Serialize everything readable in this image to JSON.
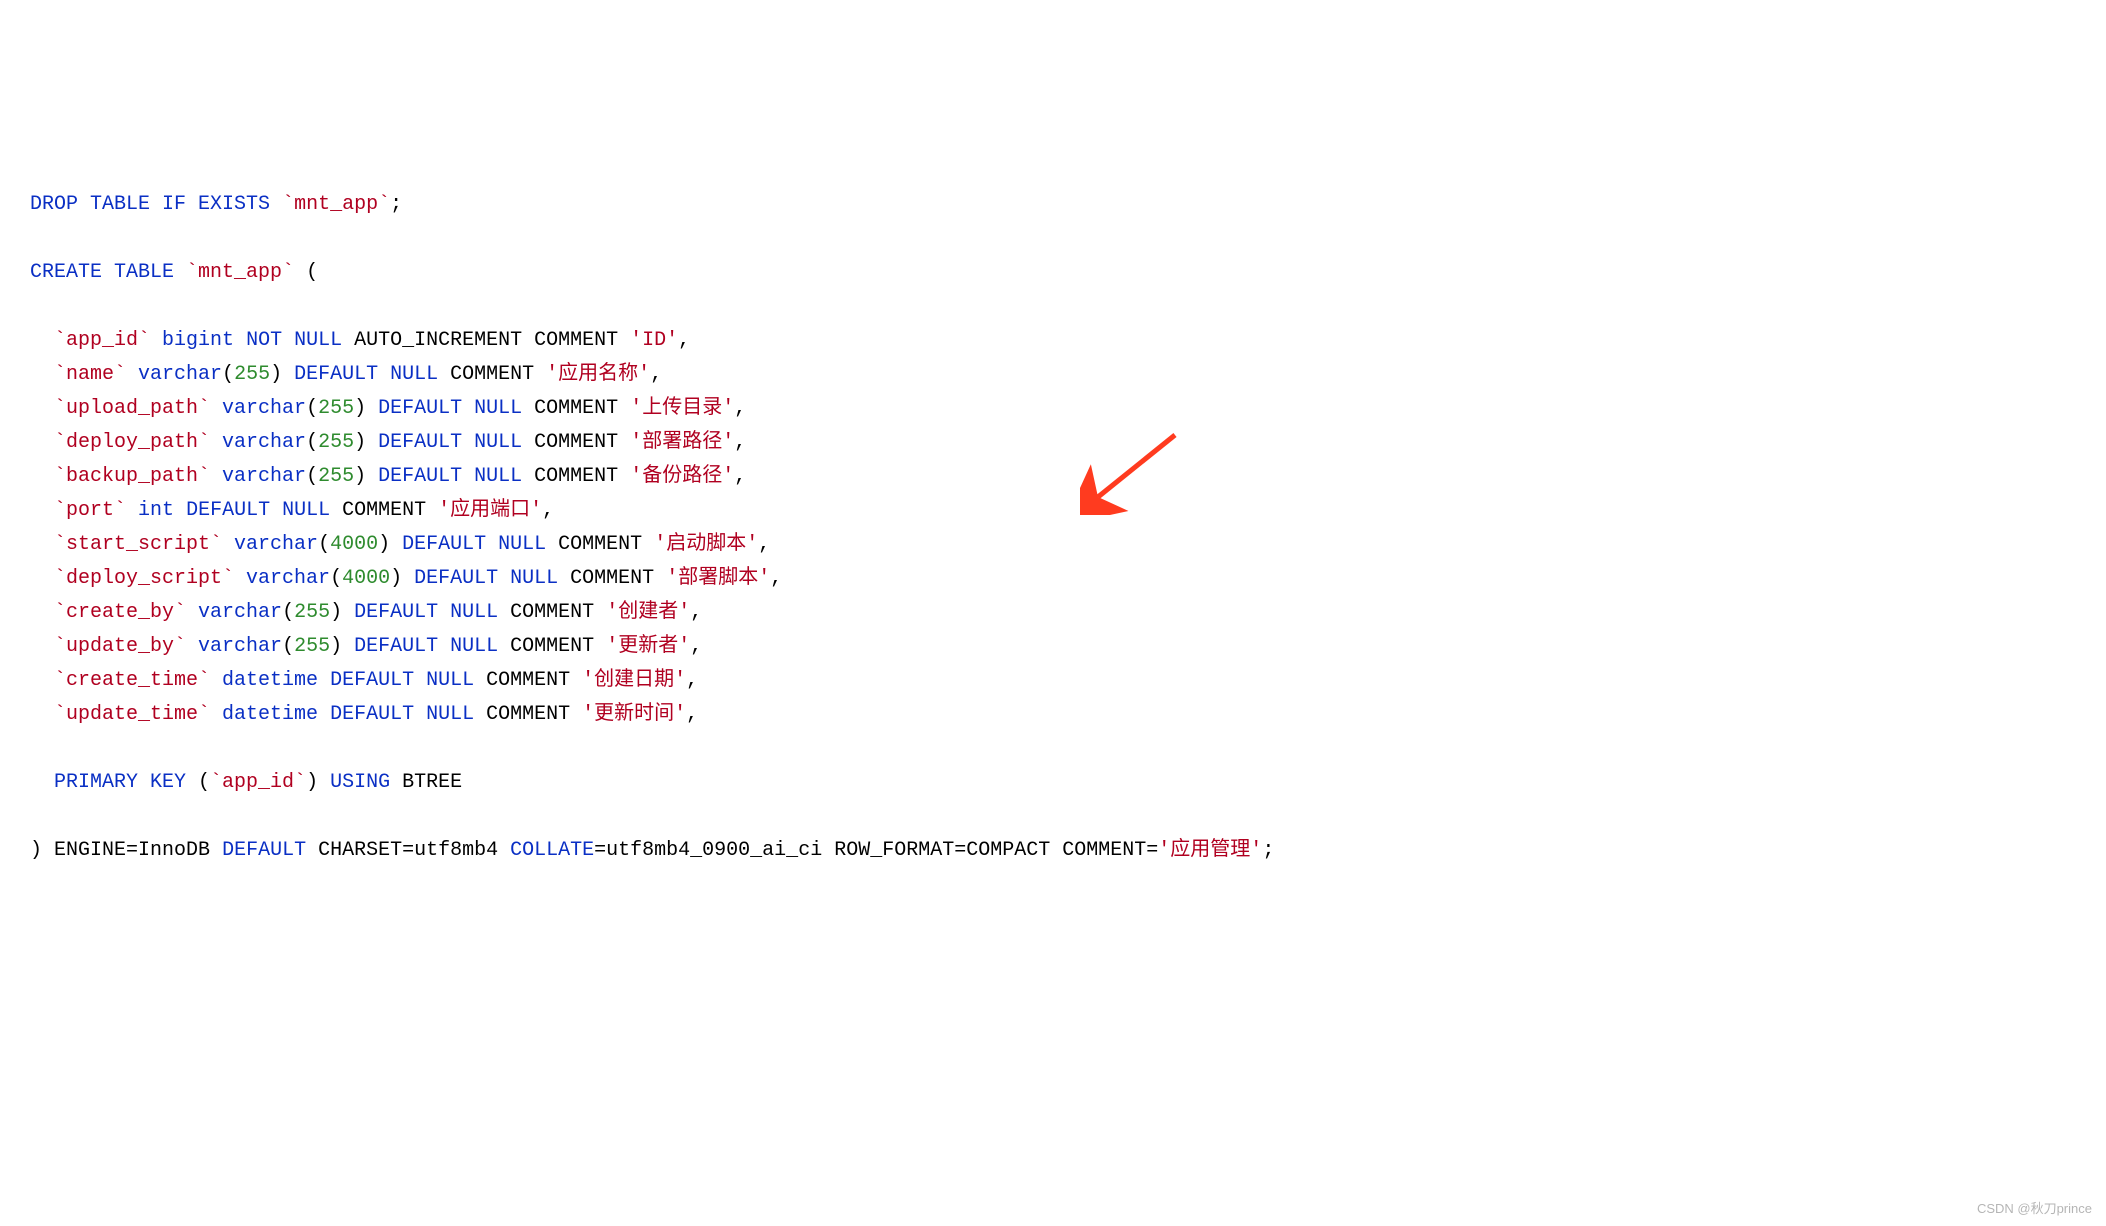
{
  "sql": {
    "drop": {
      "kw": "DROP TABLE IF EXISTS",
      "name": "`mnt_app`",
      "semi": ";"
    },
    "create": {
      "kw": "CREATE TABLE",
      "name": "`mnt_app`",
      "open": " ("
    },
    "cols": [
      {
        "name": "`app_id`",
        "type": "bigint",
        "size": "",
        "mid": "NOT NULL",
        "extra": "AUTO_INCREMENT COMMENT ",
        "str": "'ID'",
        "tail": ","
      },
      {
        "name": "`name`",
        "type": "varchar",
        "size": "255",
        "mid": "DEFAULT NULL",
        "extra": "COMMENT ",
        "str": "'应用名称'",
        "tail": ","
      },
      {
        "name": "`upload_path`",
        "type": "varchar",
        "size": "255",
        "mid": "DEFAULT NULL",
        "extra": "COMMENT ",
        "str": "'上传目录'",
        "tail": ","
      },
      {
        "name": "`deploy_path`",
        "type": "varchar",
        "size": "255",
        "mid": "DEFAULT NULL",
        "extra": "COMMENT ",
        "str": "'部署路径'",
        "tail": ","
      },
      {
        "name": "`backup_path`",
        "type": "varchar",
        "size": "255",
        "mid": "DEFAULT NULL",
        "extra": "COMMENT ",
        "str": "'备份路径'",
        "tail": ","
      },
      {
        "name": "`port`",
        "type": "int",
        "size": "",
        "mid": "DEFAULT NULL",
        "extra": "COMMENT ",
        "str": "'应用端口'",
        "tail": ","
      },
      {
        "name": "`start_script`",
        "type": "varchar",
        "size": "4000",
        "mid": "DEFAULT NULL",
        "extra": "COMMENT ",
        "str": "'启动脚本'",
        "tail": ","
      },
      {
        "name": "`deploy_script`",
        "type": "varchar",
        "size": "4000",
        "mid": "DEFAULT NULL",
        "extra": "COMMENT ",
        "str": "'部署脚本'",
        "tail": ","
      },
      {
        "name": "`create_by`",
        "type": "varchar",
        "size": "255",
        "mid": "DEFAULT NULL",
        "extra": "COMMENT ",
        "str": "'创建者'",
        "tail": ","
      },
      {
        "name": "`update_by`",
        "type": "varchar",
        "size": "255",
        "mid": "DEFAULT NULL",
        "extra": "COMMENT ",
        "str": "'更新者'",
        "tail": ","
      },
      {
        "name": "`create_time`",
        "type": "datetime",
        "size": "",
        "mid": "DEFAULT NULL",
        "extra": "COMMENT ",
        "str": "'创建日期'",
        "tail": ","
      },
      {
        "name": "`update_time`",
        "type": "datetime",
        "size": "",
        "mid": "DEFAULT NULL",
        "extra": "COMMENT ",
        "str": "'更新时间'",
        "tail": ","
      }
    ],
    "pk": {
      "kw1": "PRIMARY KEY",
      "open": " (",
      "name": "`app_id`",
      "close": ") ",
      "kw2": "USING",
      "btree": " BTREE"
    },
    "tail": {
      "close": ") ",
      "engine_lbl": "ENGINE",
      "eq1": "=",
      "engine": "InnoDB ",
      "default": "DEFAULT",
      "charset_lbl": " CHARSET",
      "eq2": "=",
      "charset": "utf8mb4 ",
      "collate": "COLLATE",
      "eq3": "=",
      "collation": "utf8mb4_0900_ai_ci ",
      "rowfmt_lbl": "ROW_FORMAT",
      "eq4": "=",
      "rowfmt": "COMPACT ",
      "comment_lbl": "COMMENT",
      "eq5": "=",
      "comment_str": "'应用管理'",
      "semi": ";"
    }
  },
  "watermark": "CSDN @秋刀prince"
}
